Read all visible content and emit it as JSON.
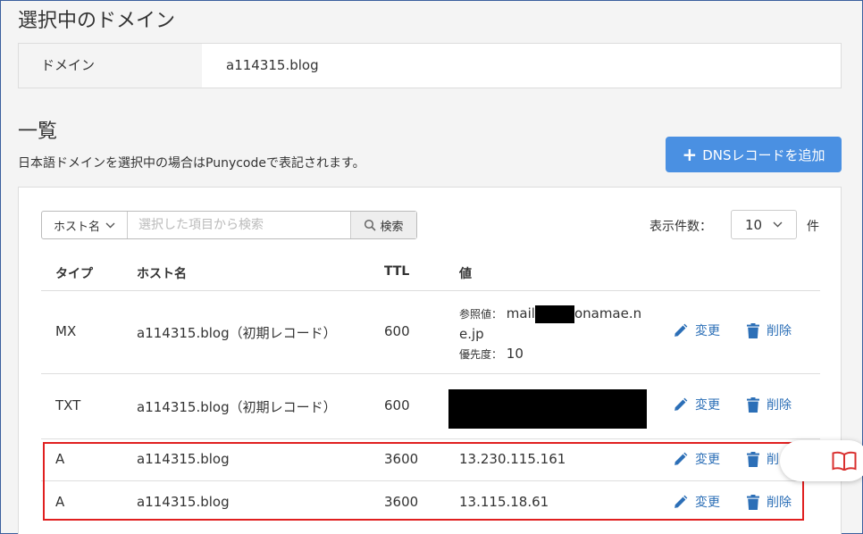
{
  "page": {
    "selected_domain_title": "選択中のドメイン",
    "list_title": "一覧",
    "note": "日本語ドメインを選択中の場合はPunycodeで表記されます。"
  },
  "domain": {
    "label": "ドメイン",
    "value": "a114315.blog"
  },
  "add_button": {
    "label": "DNSレコードを追加"
  },
  "search": {
    "field_select": "ホスト名",
    "placeholder": "選択した項目から検索",
    "button": "検索"
  },
  "count": {
    "label": "表示件数：",
    "value": "10",
    "unit": "件"
  },
  "table": {
    "headers": [
      "タイプ",
      "ホスト名",
      "TTL",
      "値"
    ],
    "rows": [
      {
        "type": "MX",
        "host": "a114315.blog（初期レコード）",
        "ttl": "600",
        "ref_label": "参照値：",
        "ref_prefix": "mail",
        "ref_suffix": "onamae.n",
        "ref_line2": "e.jp",
        "priority_label": "優先度：",
        "priority": "10"
      },
      {
        "type": "TXT",
        "host": "a114315.blog（初期レコード）",
        "ttl": "600",
        "value": ""
      },
      {
        "type": "A",
        "host": "a114315.blog",
        "ttl": "3600",
        "value": "13.230.115.161"
      },
      {
        "type": "A",
        "host": "a114315.blog",
        "ttl": "3600",
        "value": "13.115.18.61"
      }
    ],
    "edit_label": "変更",
    "delete_label": "削除",
    "delete_label_partial": "削"
  },
  "colors": {
    "accent": "#4a90e2",
    "link": "#2c6fb7",
    "highlight": "#e01f1f",
    "book_icon": "#d9302f"
  },
  "icons": [
    "chevron-down-icon",
    "search-icon",
    "pencil-icon",
    "trash-icon",
    "book-icon"
  ]
}
